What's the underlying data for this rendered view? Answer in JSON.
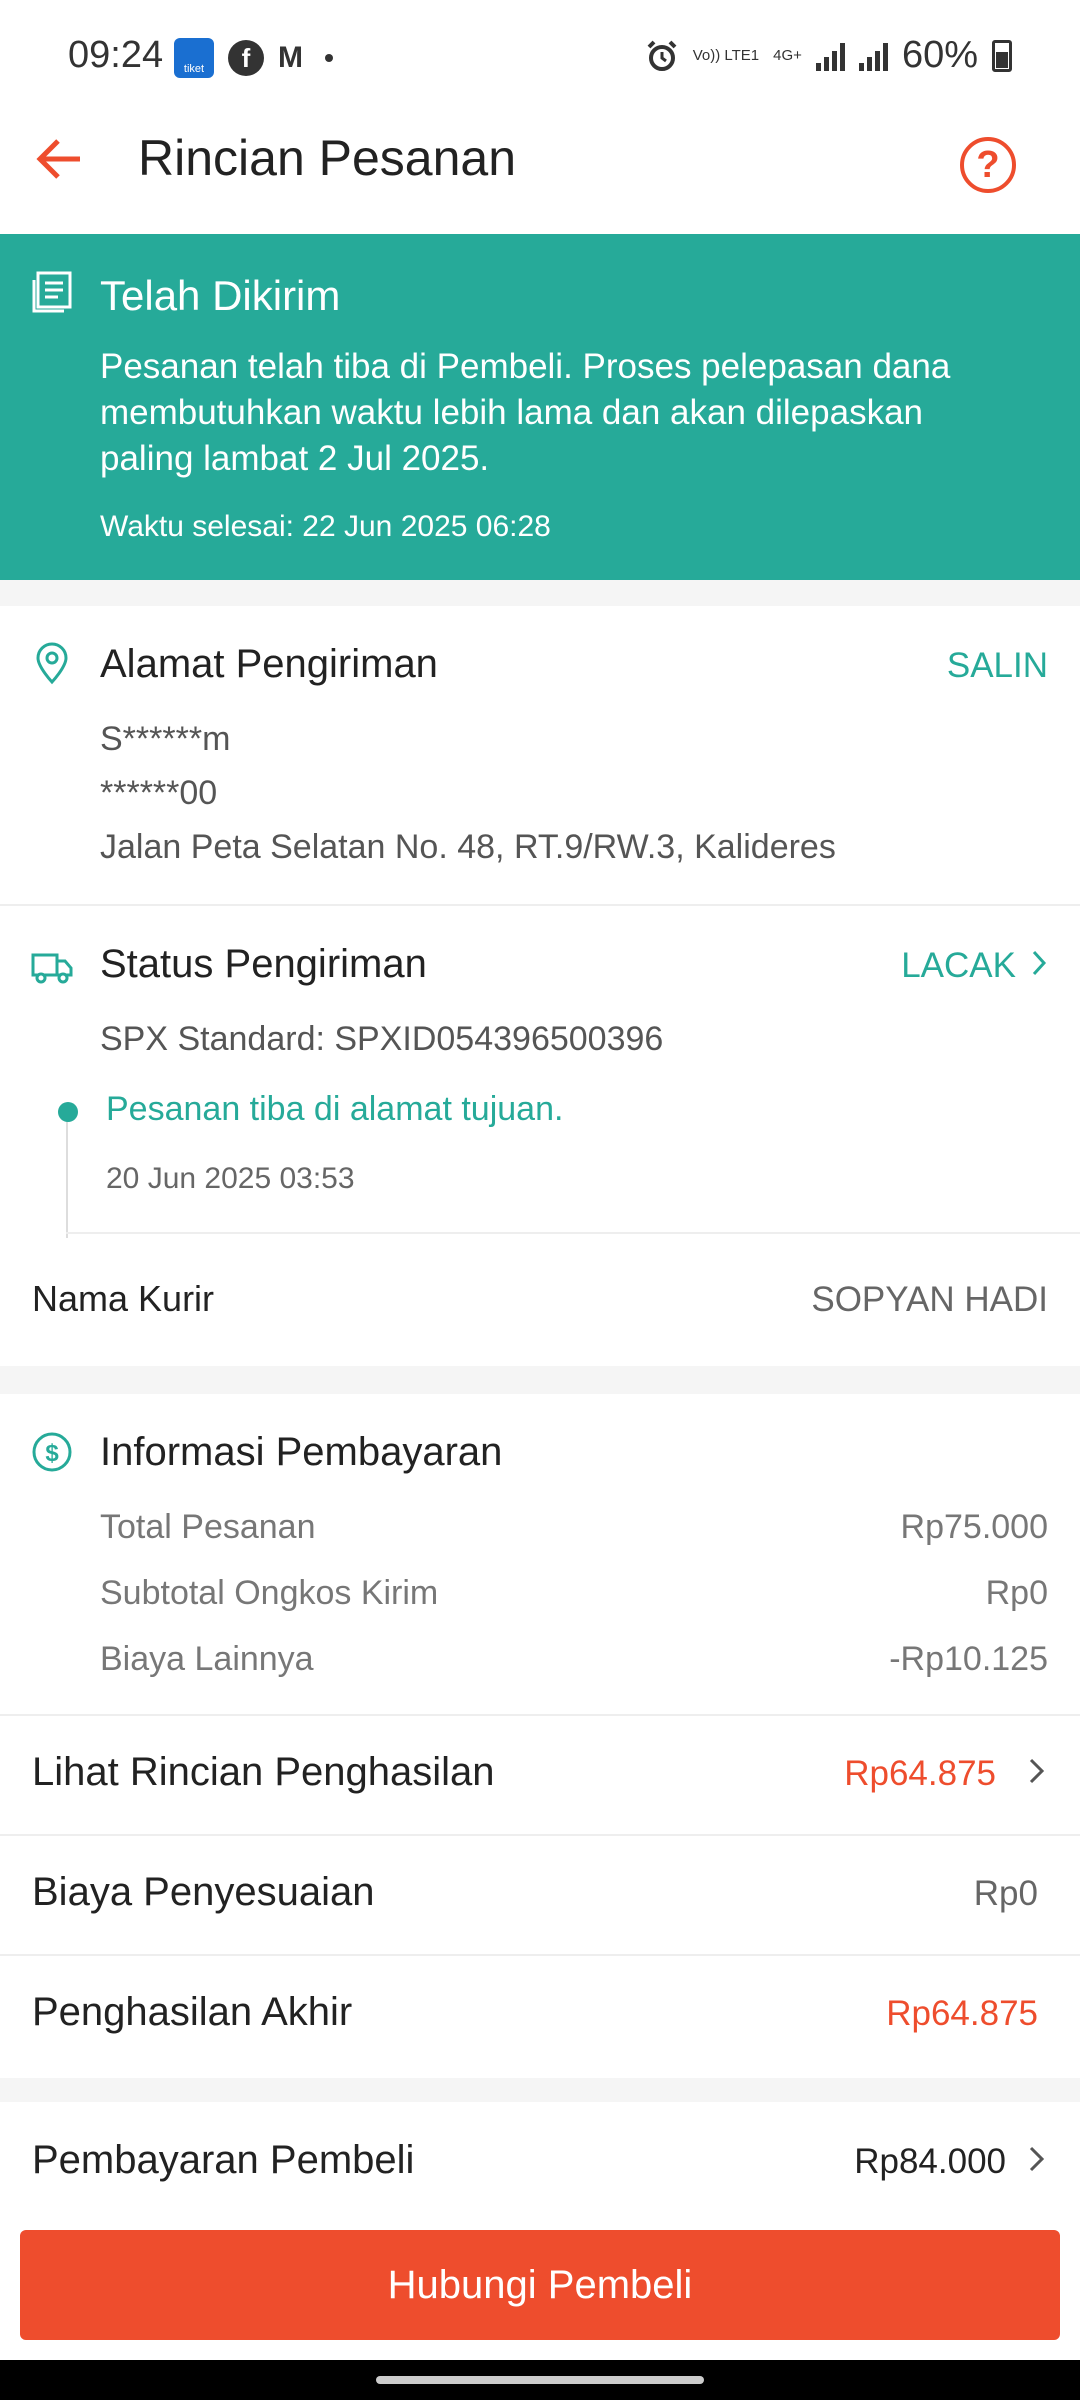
{
  "status_bar": {
    "time": "09:24",
    "left_icons": [
      "tiket-app-icon",
      "facebook-icon",
      "gmail-icon",
      "notification-dot"
    ],
    "tiket_label": "tiket",
    "volte": "Vo)) LTE1",
    "network": "4G+",
    "battery": "60%"
  },
  "app_bar": {
    "title": "Rincian Pesanan",
    "back_icon": "arrow-left-icon",
    "help_icon": "question-circle-icon",
    "help_glyph": "?"
  },
  "banner": {
    "title": "Telah Dikirim",
    "message": "Pesanan telah tiba di Pembeli. Proses pelepasan dana membutuhkan waktu lebih lama dan akan dilepaskan paling lambat 2 Jul 2025.",
    "completion_time": "Waktu selesai: 22 Jun 2025 06:28",
    "icon": "document-list-icon"
  },
  "address": {
    "title": "Alamat Pengiriman",
    "action": "SALIN",
    "name": "S******m",
    "phone": "******00",
    "street": "Jalan Peta Selatan No. 48, RT.9/RW.3, Kalideres",
    "icon": "location-pin-icon"
  },
  "shipping": {
    "title": "Status Pengiriman",
    "action": "LACAK",
    "service": "SPX Standard: SPXID054396500396",
    "latest_event": "Pesanan tiba di alamat tujuan.",
    "latest_event_time": "20 Jun 2025 03:53",
    "courier_label": "Nama Kurir",
    "courier_name": "SOPYAN HADI",
    "icon": "truck-icon"
  },
  "payment": {
    "title": "Informasi Pembayaran",
    "icon": "dollar-circle-icon",
    "rows": [
      {
        "label": "Total Pesanan",
        "value": "Rp75.000"
      },
      {
        "label": "Subtotal Ongkos Kirim",
        "value": "Rp0"
      },
      {
        "label": "Biaya Lainnya",
        "value": "-Rp10.125"
      }
    ]
  },
  "income": {
    "details_label": "Lihat Rincian Penghasilan",
    "details_value": "Rp64.875",
    "adjustment_label": "Biaya Penyesuaian",
    "adjustment_value": "Rp0",
    "final_label": "Penghasilan Akhir",
    "final_value": "Rp64.875"
  },
  "buyer_payment": {
    "label": "Pembayaran Pembeli",
    "value": "Rp84.000"
  },
  "cta": {
    "label": "Hubungi Pembeli"
  },
  "colors": {
    "accent_orange": "#ee4d2d",
    "teal": "#26aa99"
  }
}
